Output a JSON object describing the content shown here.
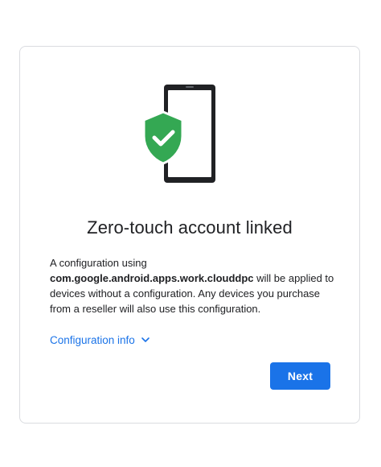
{
  "dialog": {
    "title": "Zero-touch account linked",
    "description_prefix": "A configuration using",
    "package_name": "com.google.android.apps.work.clouddpc",
    "description_suffix": " will be applied to devices without a configuration. Any devices you purchase from a reseller will also use this configuration.",
    "config_link_label": "Configuration info",
    "next_button_label": "Next"
  },
  "icons": {
    "illustration": "phone-shield-check-icon",
    "expand": "chevron-down-icon"
  },
  "colors": {
    "accent": "#1a73e8",
    "shield": "#34a853",
    "phone": "#202124"
  }
}
